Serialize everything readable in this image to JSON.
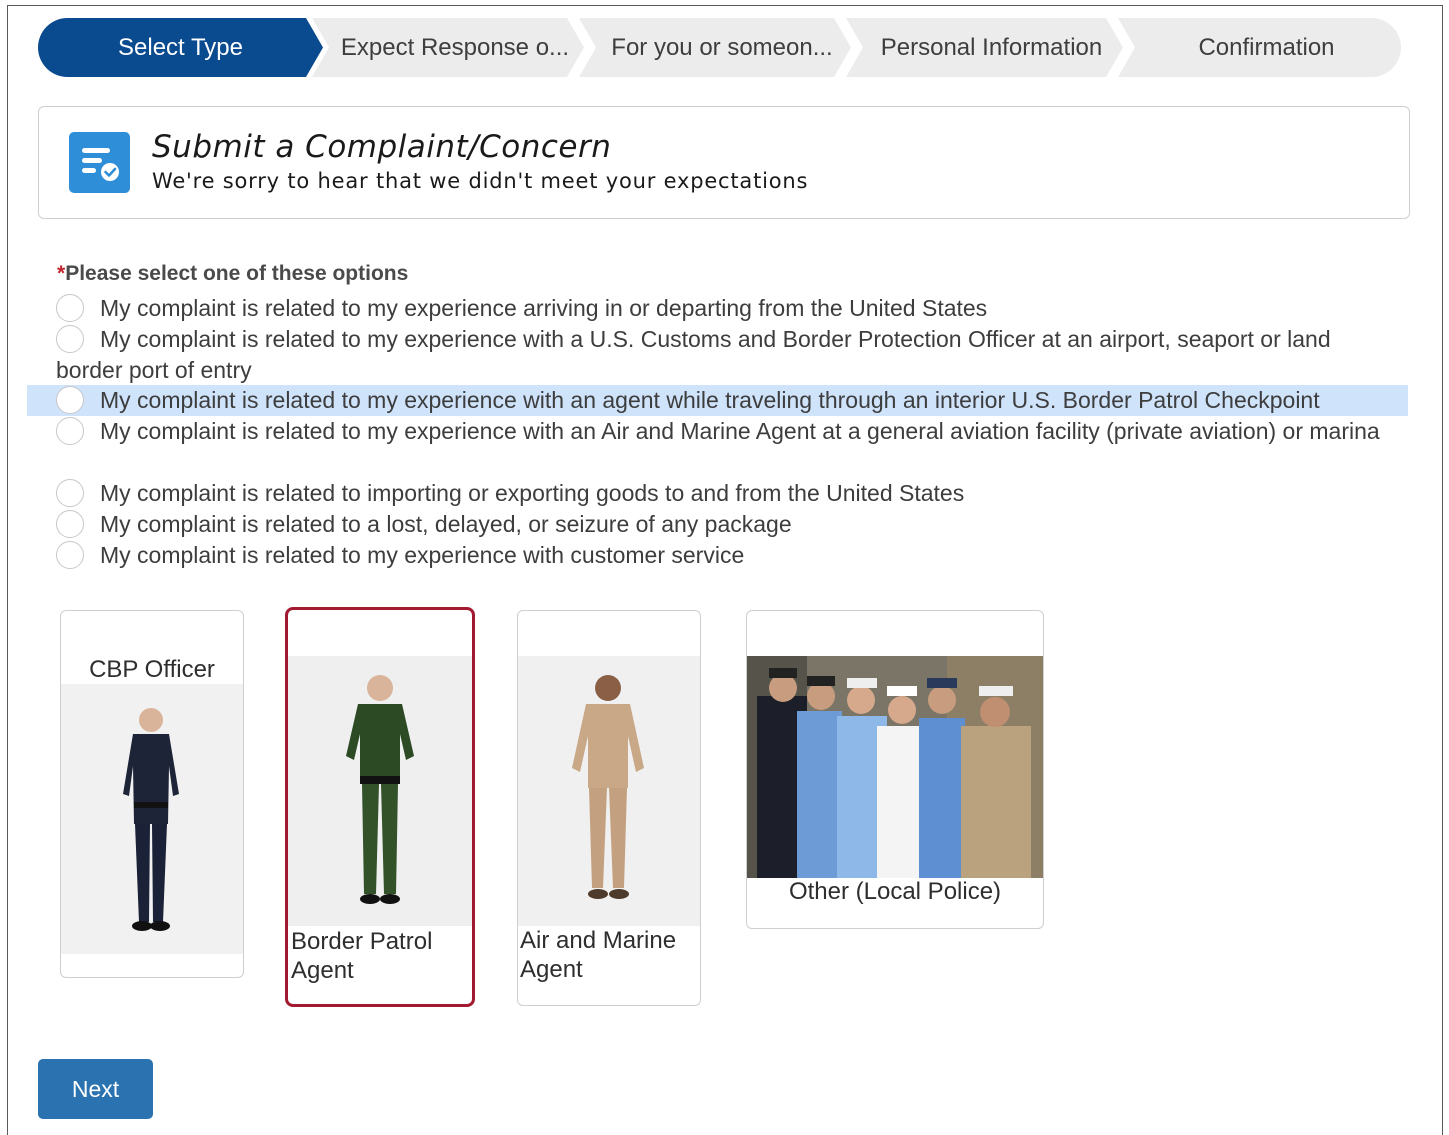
{
  "stepper": {
    "steps": [
      {
        "label": "Select Type",
        "active": true
      },
      {
        "label": "Expect Response o..."
      },
      {
        "label": "For you or someon..."
      },
      {
        "label": "Personal Information"
      },
      {
        "label": "Confirmation"
      }
    ],
    "active_color": "#0a4a8e",
    "inactive_color": "#ececec"
  },
  "header": {
    "title": "Submit a Complaint/Concern",
    "subtitle": "We're sorry to hear that we didn't meet your expectations",
    "icon": "form-check-icon",
    "icon_color": "#2e8fd8"
  },
  "question": {
    "required_marker": "*",
    "label": "Please select one of these options",
    "options": [
      "My complaint is related to my experience arriving in or departing from the United States",
      "My complaint is related to my experience with a U.S. Customs and Border Protection Officer at an airport, seaport or land border port of entry",
      "My complaint is related to my experience with an agent while traveling through an interior U.S. Border Patrol Checkpoint",
      "My complaint is related to my experience with an Air and Marine Agent at a general aviation facility (private aviation) or marina",
      "My complaint is related to importing or exporting goods to and from the United States",
      "My complaint is related to a lost, delayed, or seizure of any package",
      "My complaint is related to my experience with customer service"
    ],
    "highlighted_option": 3
  },
  "cards": [
    {
      "label": "CBP Officer"
    },
    {
      "label": "Border Patrol Agent",
      "selected": true
    },
    {
      "label": "Air and Marine Agent"
    },
    {
      "label": "Other (Local Police)"
    }
  ],
  "colors": {
    "selected_border": "#a3192f",
    "highlight": "#cfe3fb",
    "button": "#2a72b0"
  },
  "next_button": "Next"
}
